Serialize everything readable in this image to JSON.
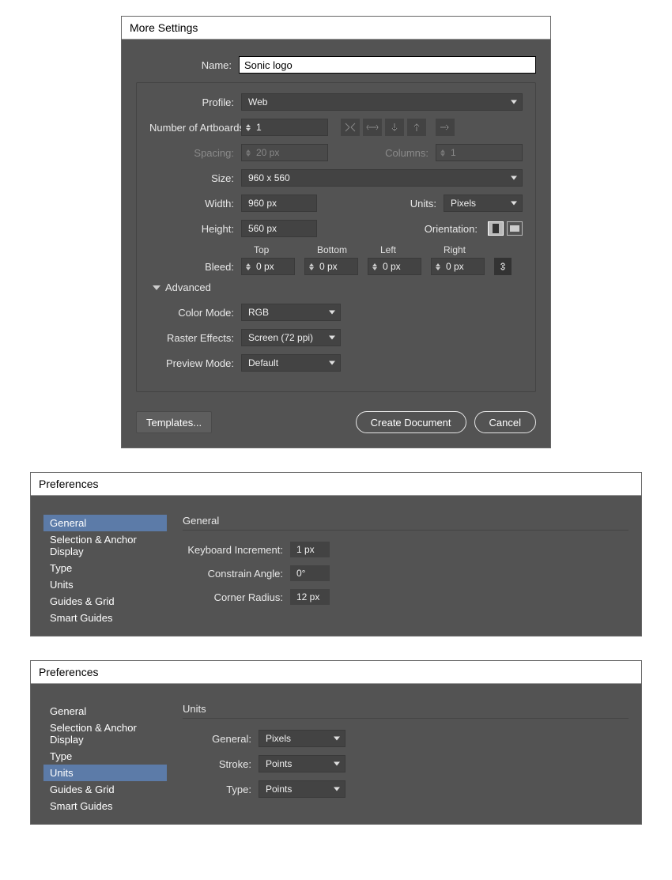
{
  "dialog1": {
    "title": "More Settings",
    "name_label": "Name:",
    "name_value": "Sonic logo",
    "profile_label": "Profile:",
    "profile_value": "Web",
    "artboards_label": "Number of Artboards:",
    "artboards_value": "1",
    "spacing_label": "Spacing:",
    "spacing_value": "20 px",
    "columns_label": "Columns:",
    "columns_value": "1",
    "size_label": "Size:",
    "size_value": "960 x 560",
    "width_label": "Width:",
    "width_value": "960 px",
    "units_label": "Units:",
    "units_value": "Pixels",
    "height_label": "Height:",
    "height_value": "560 px",
    "orientation_label": "Orientation:",
    "bleed_label": "Bleed:",
    "bleed_headers": {
      "top": "Top",
      "bottom": "Bottom",
      "left": "Left",
      "right": "Right"
    },
    "bleed_values": {
      "top": "0 px",
      "bottom": "0 px",
      "left": "0 px",
      "right": "0 px"
    },
    "advanced_label": "Advanced",
    "color_mode_label": "Color Mode:",
    "color_mode_value": "RGB",
    "raster_label": "Raster Effects:",
    "raster_value": "Screen (72 ppi)",
    "preview_label": "Preview Mode:",
    "preview_value": "Default",
    "templates_btn": "Templates...",
    "create_btn": "Create Document",
    "cancel_btn": "Cancel"
  },
  "pref1": {
    "title": "Preferences",
    "sidebar": [
      "General",
      "Selection & Anchor Display",
      "Type",
      "Units",
      "Guides & Grid",
      "Smart Guides"
    ],
    "active_index": 0,
    "section": "General",
    "rows": {
      "keyboard_label": "Keyboard Increment:",
      "keyboard_value": "1 px",
      "constrain_label": "Constrain Angle:",
      "constrain_value": "0°",
      "corner_label": "Corner Radius:",
      "corner_value": "12 px"
    }
  },
  "pref2": {
    "title": "Preferences",
    "sidebar": [
      "General",
      "Selection & Anchor Display",
      "Type",
      "Units",
      "Guides & Grid",
      "Smart Guides"
    ],
    "active_index": 3,
    "section": "Units",
    "rows": {
      "general_label": "General:",
      "general_value": "Pixels",
      "stroke_label": "Stroke:",
      "stroke_value": "Points",
      "type_label": "Type:",
      "type_value": "Points"
    }
  }
}
